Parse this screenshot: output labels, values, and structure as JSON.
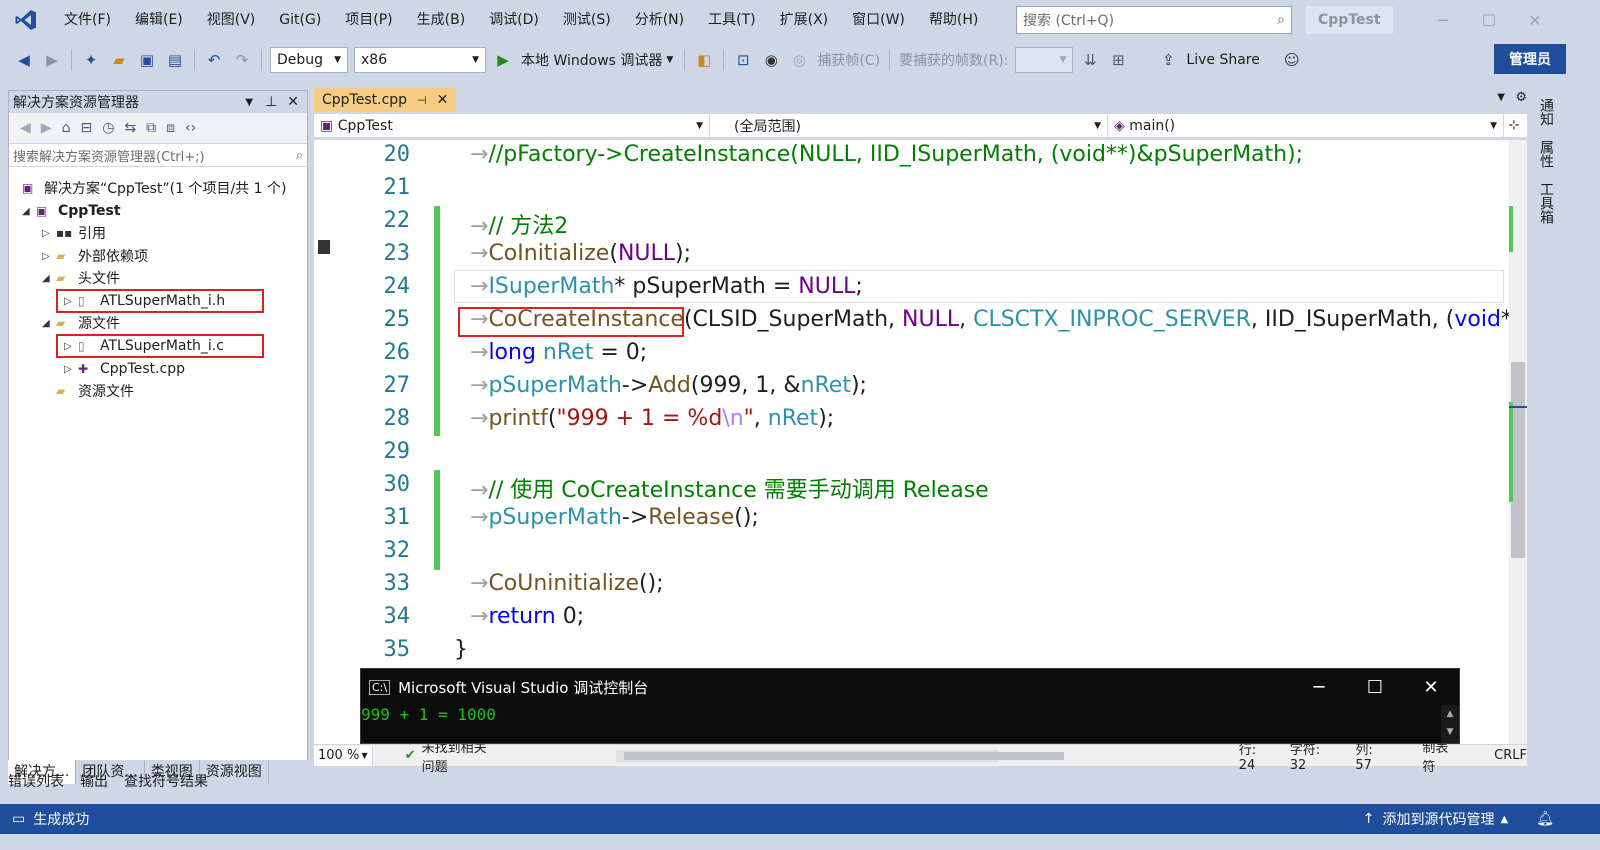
{
  "menubar": {
    "items": [
      "文件(F)",
      "编辑(E)",
      "视图(V)",
      "Git(G)",
      "项目(P)",
      "生成(B)",
      "调试(D)",
      "测试(S)",
      "分析(N)",
      "工具(T)",
      "扩展(X)",
      "窗口(W)",
      "帮助(H)"
    ],
    "search_placeholder": "搜索 (Ctrl+Q)",
    "solution_name": "CppTest"
  },
  "toolbar": {
    "config": "Debug",
    "platform": "x86",
    "run_label": "本地 Windows 调试器",
    "capture_label": "捕获帧(C)",
    "frames_label": "要捕获的帧数(R):",
    "live_share": "Live Share",
    "admin": "管理员"
  },
  "solution_explorer": {
    "title": "解决方案资源管理器",
    "search_placeholder": "搜索解决方案资源管理器(Ctrl+;)",
    "tree": [
      {
        "label": "解决方案“CppTest”(1 个项目/共 1 个)",
        "bold": false
      },
      {
        "label": "CppTest",
        "bold": true
      },
      {
        "label": "引用"
      },
      {
        "label": "外部依赖项"
      },
      {
        "label": "头文件"
      },
      {
        "label": "ATLSuperMath_i.h"
      },
      {
        "label": "源文件"
      },
      {
        "label": "ATLSuperMath_i.c"
      },
      {
        "label": "CppTest.cpp"
      },
      {
        "label": "资源文件"
      }
    ],
    "tabs": [
      "解决方...",
      "团队资...",
      "类视图",
      "资源视图"
    ]
  },
  "editor": {
    "tab_label": "CppTest.cpp",
    "nav_project": "CppTest",
    "nav_scope": "(全局范围)",
    "nav_member": "main()",
    "line_numbers": [
      "20",
      "21",
      "22",
      "23",
      "24",
      "25",
      "26",
      "27",
      "28",
      "29",
      "30",
      "31",
      "32",
      "33",
      "34",
      "35"
    ],
    "zoom": "100 %",
    "issues": "未找到相关问题",
    "pos_line": "行: 24",
    "pos_char": "字符: 32",
    "pos_col": "列: 57",
    "tab_mode": "制表符",
    "eol": "CRLF"
  },
  "right_tabs": [
    "通知",
    "属性",
    "工具箱"
  ],
  "console": {
    "title": "Microsoft Visual Studio 调试控制台",
    "output": "999 + 1 = 1000"
  },
  "bottom_tabs": [
    "错误列表",
    "输出",
    "查找符号结果"
  ],
  "statusbar": {
    "left": "生成成功",
    "right": "添加到源代码管理"
  }
}
